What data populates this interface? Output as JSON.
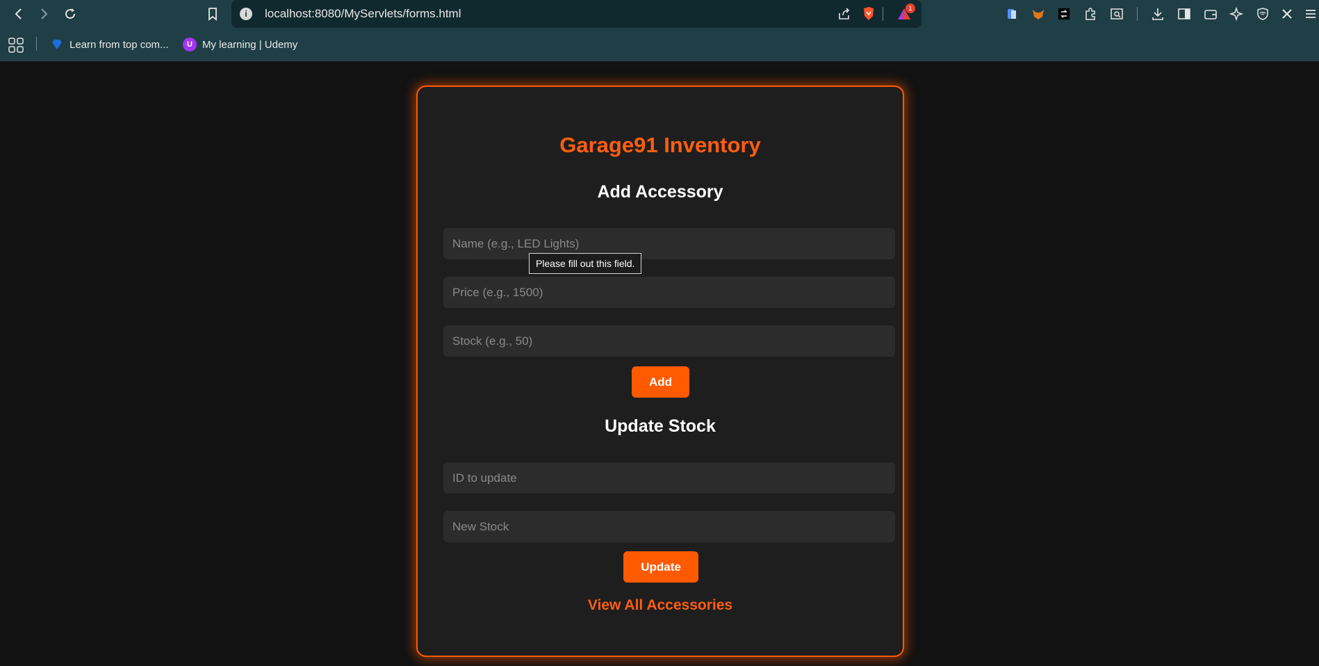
{
  "browser": {
    "url": "localhost:8080/MyServlets/forms.html",
    "shields_badge": "1",
    "bookmarks": [
      {
        "label": "Learn from top com...",
        "icon": "diamond-icon"
      },
      {
        "label": "My learning | Udemy",
        "icon": "udemy-icon"
      }
    ]
  },
  "page": {
    "title": "Garage91 Inventory",
    "add_section": {
      "heading": "Add Accessory",
      "name_placeholder": "Name (e.g., LED Lights)",
      "price_placeholder": "Price (e.g., 1500)",
      "stock_placeholder": "Stock (e.g., 50)",
      "submit_label": "Add"
    },
    "validation_tooltip": "Please fill out this field.",
    "update_section": {
      "heading": "Update Stock",
      "id_placeholder": "ID to update",
      "stock_placeholder": "New Stock",
      "submit_label": "Update"
    },
    "view_all_link": "View All Accessories"
  },
  "colors": {
    "accent": "#ff5a00",
    "card_bg": "#1e1e1e",
    "page_bg": "#121212",
    "input_bg": "#2c2c2c",
    "chrome_bg": "#1f3e45"
  }
}
